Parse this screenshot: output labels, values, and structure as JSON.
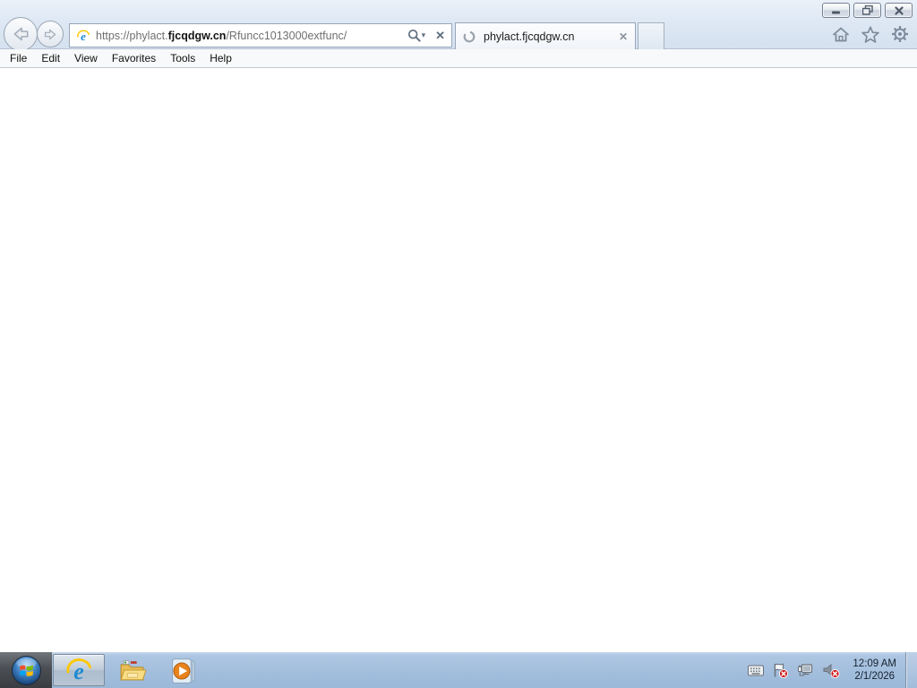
{
  "window": {
    "controls": [
      "minimize",
      "restore-down",
      "close"
    ]
  },
  "browser": {
    "address": {
      "prefix": "https://phylact.",
      "domain": "fjcqdgw.cn",
      "path": "/Rfuncc1013000extfunc/",
      "full_url": "https://phylact.fjcqdgw.cn/Rfuncc1013000extfunc/"
    },
    "tabs": [
      {
        "title": "phylact.fjcqdgw.cn"
      }
    ],
    "menu_items": [
      "File",
      "Edit",
      "View",
      "Favorites",
      "Tools",
      "Help"
    ]
  },
  "glyphs": {
    "close_x": "✕",
    "dropdown_caret": "▾"
  },
  "taskbar": {
    "clock_time": "12:09 AM",
    "clock_date": "2/1/2026"
  },
  "icons": {
    "titlebar": [
      "minimize-icon",
      "restore-icon",
      "close-icon"
    ],
    "navigation": [
      "back-arrow-icon",
      "forward-arrow-icon"
    ],
    "address_bar": [
      "ie-favicon",
      "search-magnifier-icon",
      "dropdown-caret-icon",
      "stop-x-icon"
    ],
    "tab": [
      "loading-spinner-icon",
      "tab-close-icon"
    ],
    "command_bar": [
      "home-icon",
      "favorites-star-icon",
      "tools-gear-icon"
    ],
    "taskbar_buttons": [
      "windows-start-orb",
      "internet-explorer-icon",
      "explorer-folder-icon",
      "media-player-icon"
    ],
    "tray": [
      "keyboard-icon",
      "action-center-flag-error-icon",
      "network-disconnected-icon",
      "volume-muted-icon"
    ]
  },
  "colors": {
    "chrome_background": "#dde7f3",
    "taskbar_background": "#a3bedd",
    "ie_blue": "#1e8ad2",
    "swoosh_yellow": "#fdc700",
    "error_badge_red": "#cf1d1d"
  }
}
